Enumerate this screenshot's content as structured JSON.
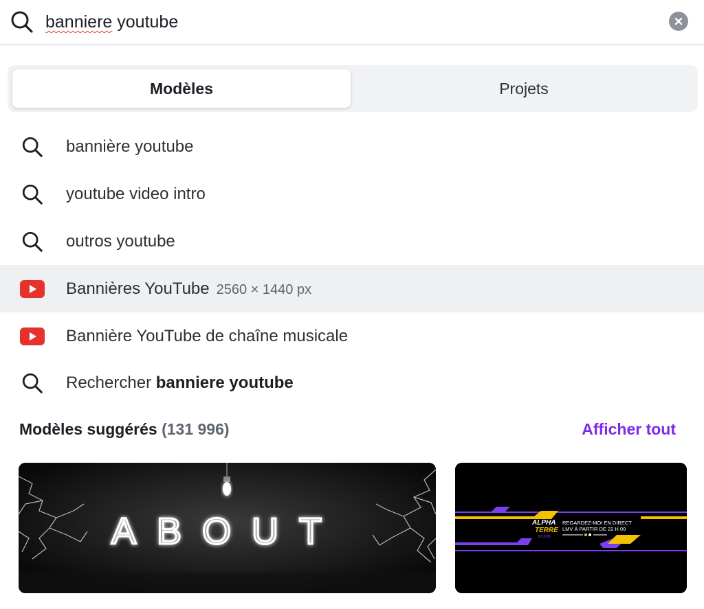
{
  "search": {
    "query_word1": "banniere",
    "query_word2": " youtube"
  },
  "tabs": {
    "templates": "Modèles",
    "projects": "Projets"
  },
  "suggestions": [
    {
      "icon": "search-icon",
      "label": "bannière youtube"
    },
    {
      "icon": "search-icon",
      "label": "youtube video intro"
    },
    {
      "icon": "search-icon",
      "label": "outros youtube"
    },
    {
      "icon": "youtube-icon",
      "label": "Bannières YouTube",
      "meta": "2560 × 1440 px"
    },
    {
      "icon": "youtube-icon",
      "label": "Bannière YouTube de chaîne musicale"
    },
    {
      "icon": "search-icon",
      "label_prefix": "Rechercher ",
      "label_bold": "banniere youtube"
    }
  ],
  "suggested": {
    "title": "Modèles suggérés",
    "count": "(131 996)",
    "see_all": "Afficher tout"
  },
  "thumbnails": {
    "t1": {
      "text": "ABOUT"
    },
    "t2": {
      "logo_line1": "ALPHA",
      "logo_line2": "TERRE",
      "logo_line3": "STUDIO",
      "line1": "REGARDEZ-MOI EN DIRECT",
      "line2": "LMV À PARTIR DE 22 H 00"
    }
  },
  "colors": {
    "accent": "#7d2ae8",
    "youtube_red": "#e5322d",
    "highlight_row": "#eef0f2"
  }
}
